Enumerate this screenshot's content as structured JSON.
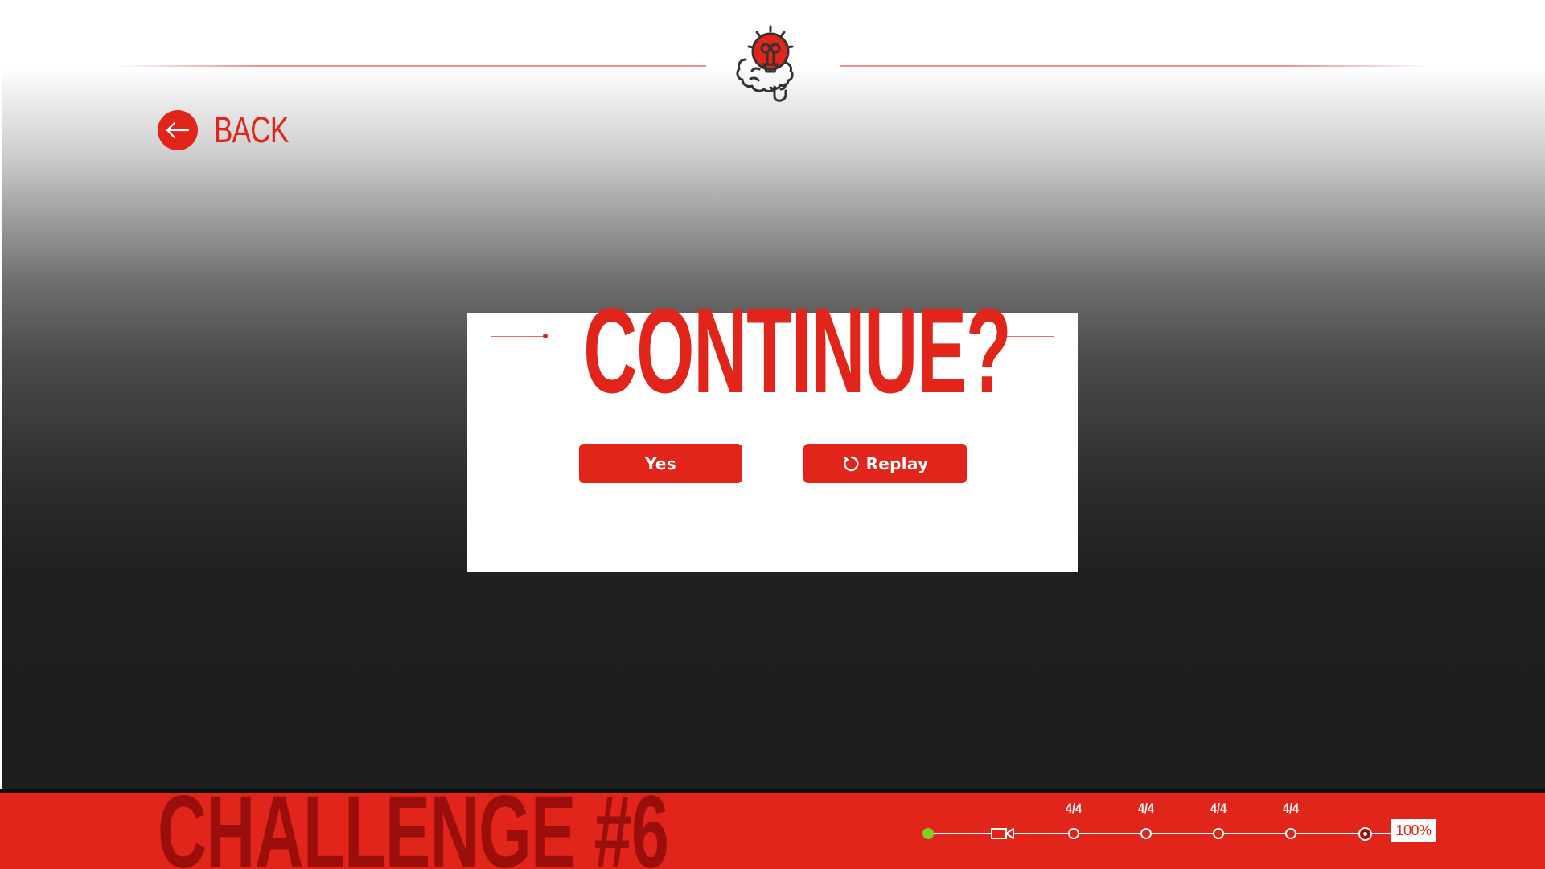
{
  "header": {
    "logo_icon": "brain-lightbulb-icon"
  },
  "back": {
    "label": "BACK",
    "icon": "arrow-left-icon"
  },
  "dialog": {
    "title": "CONTINUE?",
    "yes_label": "Yes",
    "replay_label": "Replay",
    "replay_icon": "replay-icon"
  },
  "footer": {
    "challenge_label": "CHALLENGE #6",
    "progress": {
      "steps": [
        "4/4",
        "4/4",
        "4/4",
        "4/4"
      ],
      "percent_label": "100%",
      "percent": 100
    }
  },
  "colors": {
    "accent": "#e1251b",
    "accent_dark": "#9a0f0b",
    "start_dot": "#7ed321"
  }
}
